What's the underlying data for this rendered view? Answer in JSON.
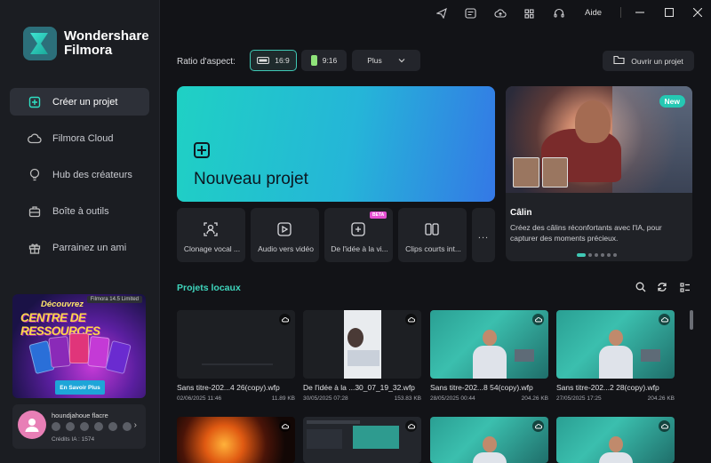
{
  "app": {
    "brand_line1": "Wondershare",
    "brand_line2": "Filmora"
  },
  "titlebar": {
    "help": "Aide",
    "icons": [
      "send-icon",
      "feedback-icon",
      "cloud-upload-icon",
      "grid-icon",
      "headset-icon"
    ]
  },
  "sidebar": {
    "items": [
      {
        "label": "Créer un projet",
        "icon": "add-square-icon",
        "active": true
      },
      {
        "label": "Filmora Cloud",
        "icon": "cloud-icon"
      },
      {
        "label": "Hub des créateurs",
        "icon": "lightbulb-icon"
      },
      {
        "label": "Boîte à outils",
        "icon": "toolbox-icon"
      },
      {
        "label": "Parrainez un ami",
        "icon": "gift-icon"
      }
    ]
  },
  "promo": {
    "tag": "Filmora 14.5 Limited",
    "line1": "Découvrez",
    "line2": "CENTRE DE RESSOURCES",
    "button": "En Savoir Plus"
  },
  "account": {
    "name": "houndjahoue flacre",
    "credits": "Crédits IA : 1574"
  },
  "aspect": {
    "label": "Ratio d'aspect:",
    "options": [
      "16:9",
      "9:16"
    ],
    "selected": "16:9",
    "more": "Plus",
    "open_project": "Ouvrir un projet"
  },
  "new_project": {
    "label": "Nouveau projet"
  },
  "tools": [
    {
      "label": "Clonage vocal ...",
      "icon": "voice-clone-icon"
    },
    {
      "label": "Audio vers vidéo",
      "icon": "audio-to-video-icon"
    },
    {
      "label": "De l'idée à la vi...",
      "icon": "idea-to-video-icon",
      "badge": "BETA"
    },
    {
      "label": "Clips courts int...",
      "icon": "short-clips-icon"
    }
  ],
  "more_tools": "...",
  "feature": {
    "badge": "New",
    "title": "Câlin",
    "description": "Créez des câlins réconfortants avec l'IA, pour capturer des moments précieux.",
    "dots_count": 6,
    "active_dot": 0
  },
  "local_projects": {
    "title": "Projets locaux",
    "items": [
      {
        "name": "Sans titre-202...4 26(copy).wfp",
        "date": "02/06/2025 11:46",
        "size": "11.89 KB",
        "thumb": "dark"
      },
      {
        "name": "De l'idée à la ...30_07_19_32.wfp",
        "date": "30/05/2025 07:28",
        "size": "153.83 KB",
        "thumb": "white-doc"
      },
      {
        "name": "Sans titre-202...8 54(copy).wfp",
        "date": "28/05/2025 00:44",
        "size": "204.26 KB",
        "thumb": "teal"
      },
      {
        "name": "Sans titre-202...2 28(copy).wfp",
        "date": "27/05/2025 17:25",
        "size": "204.26 KB",
        "thumb": "teal"
      },
      {
        "name": "",
        "date": "",
        "size": "",
        "thumb": "fire"
      },
      {
        "name": "",
        "date": "",
        "size": "",
        "thumb": "editor"
      },
      {
        "name": "",
        "date": "",
        "size": "",
        "thumb": "teal"
      },
      {
        "name": "",
        "date": "",
        "size": "",
        "thumb": "teal"
      }
    ]
  },
  "colors": {
    "accent": "#3fd6bd",
    "new_project_from": "#1fd1c4",
    "new_project_to": "#3478e6",
    "beta": "#e54fd1"
  }
}
